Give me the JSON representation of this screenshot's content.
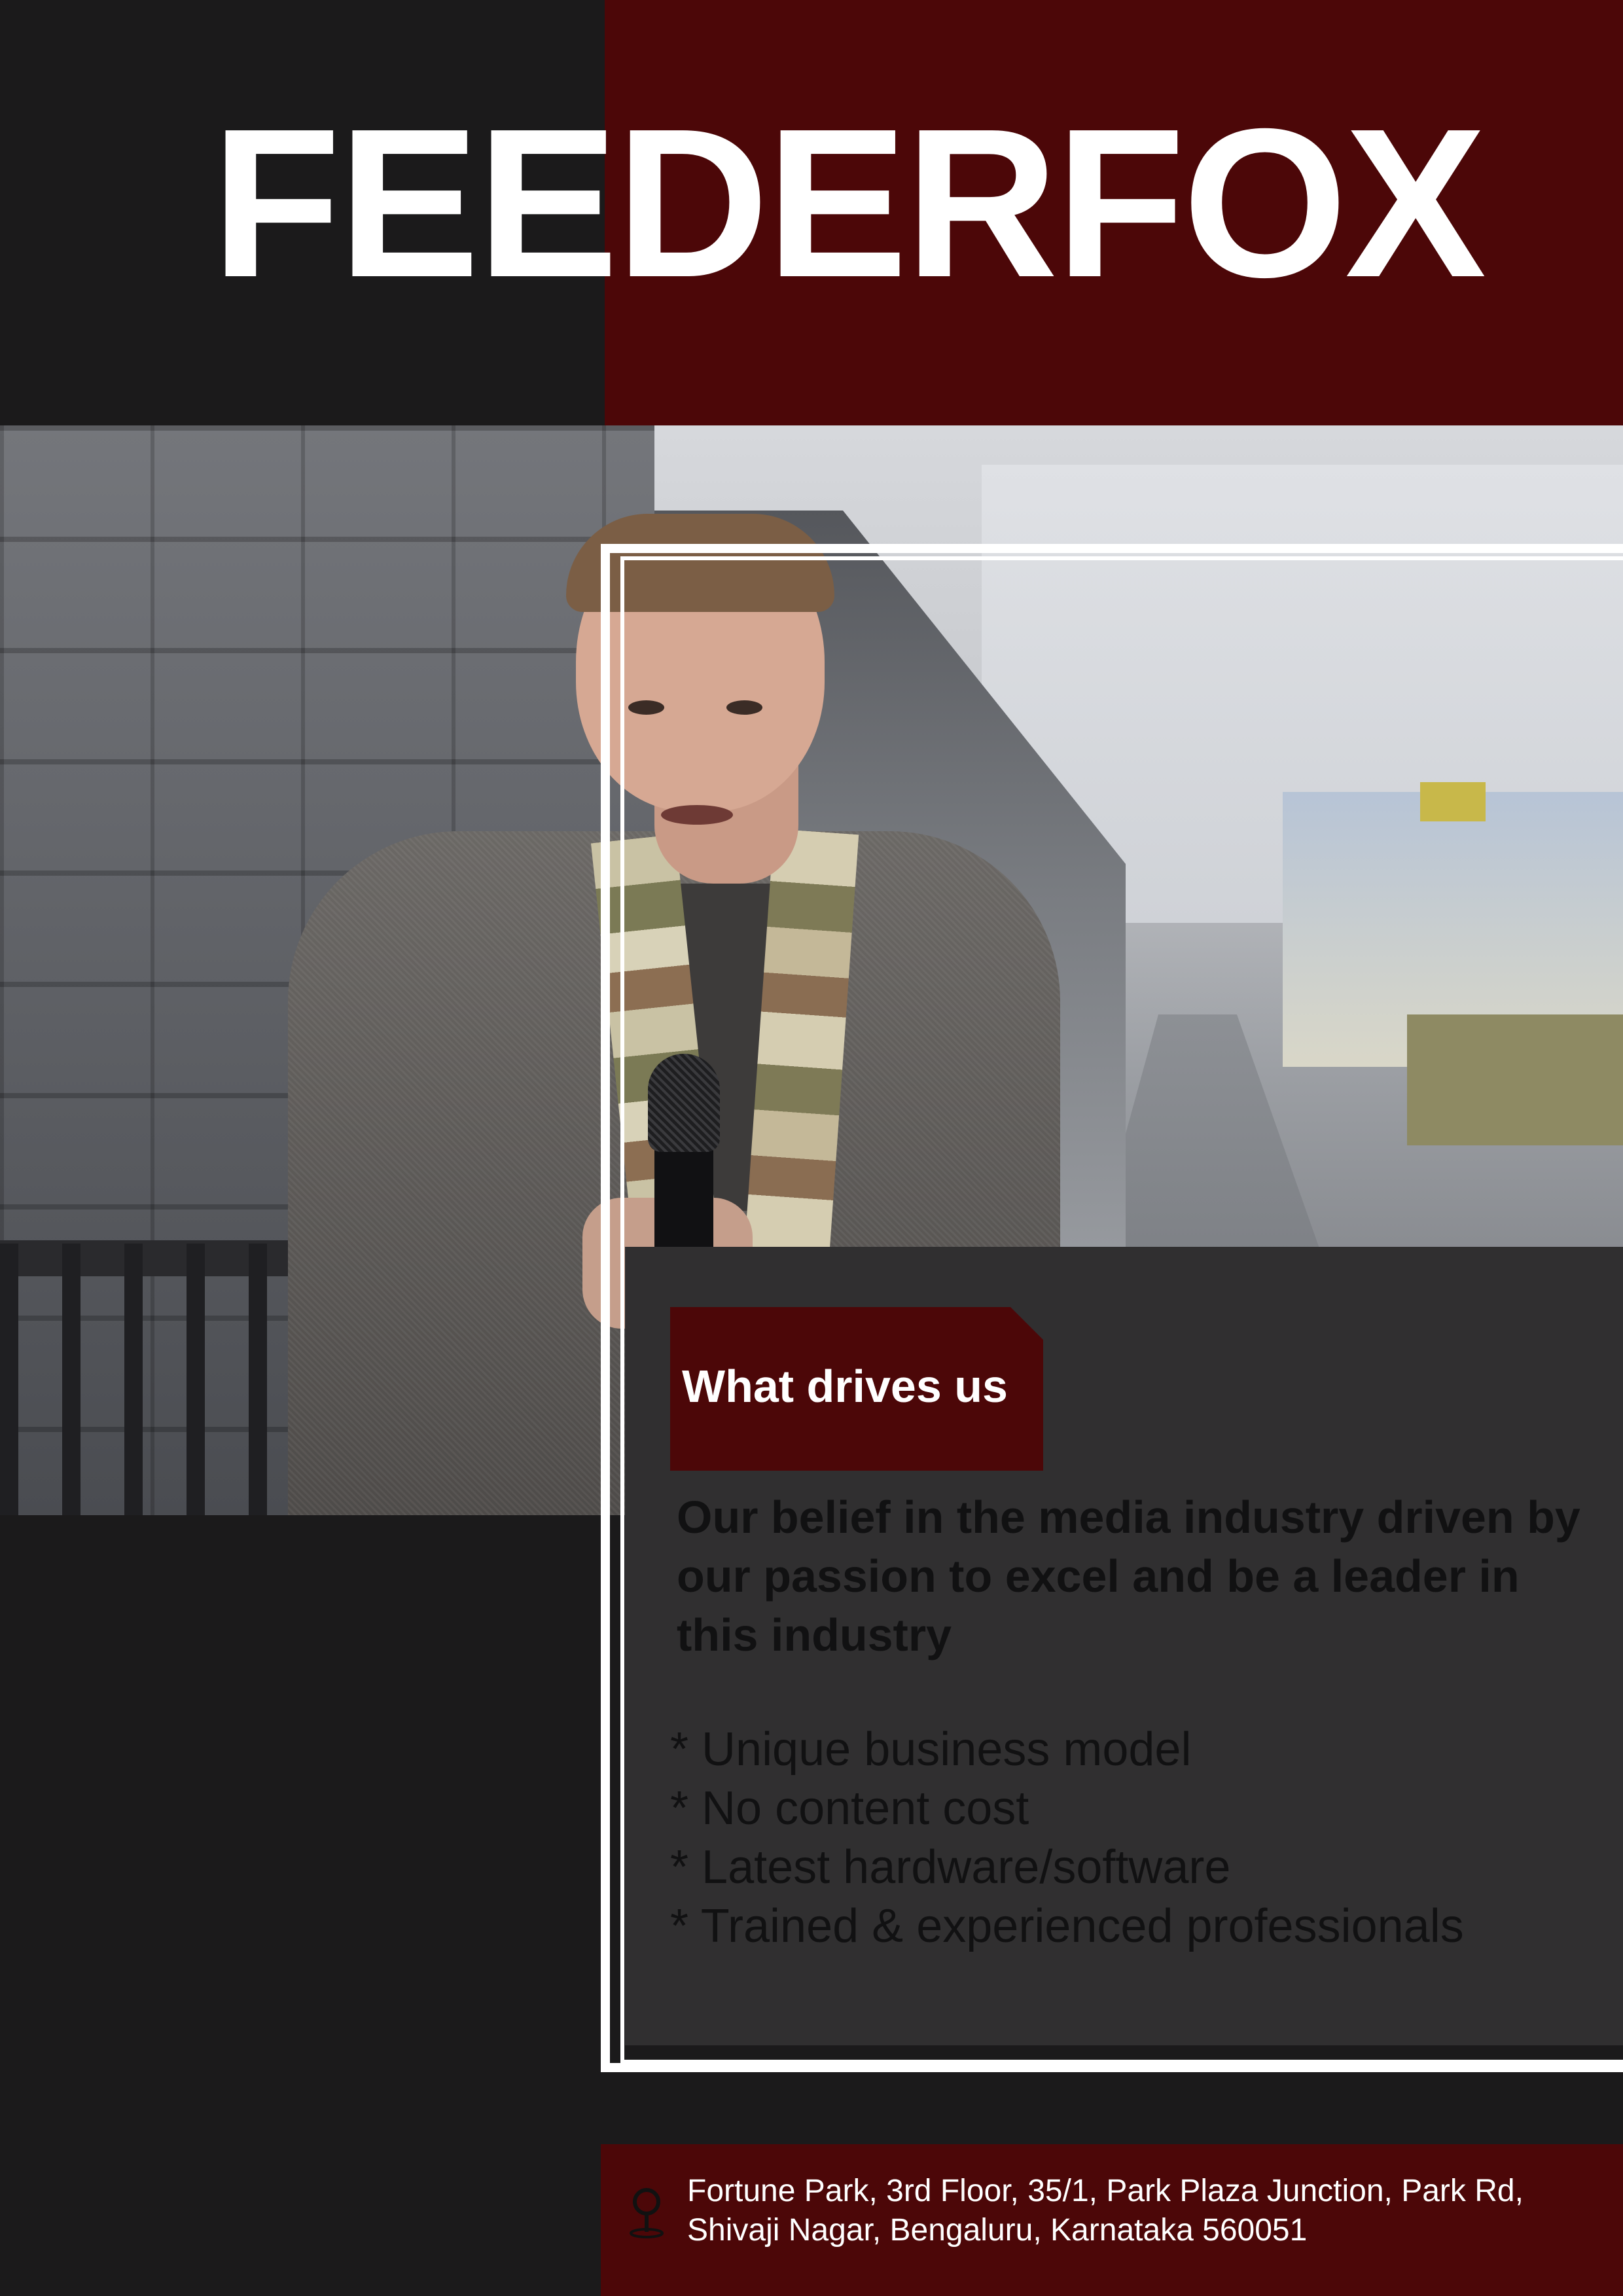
{
  "brand": {
    "title": "FEEDERFOX",
    "colors": {
      "primary": "#4c0708",
      "dark": "#1b1a1b",
      "panel": "#302f30",
      "text_light": "#ffffff"
    }
  },
  "photo": {
    "subject": "reporter-holding-microphone"
  },
  "section": {
    "tag_label": "What drives us",
    "belief_lines": [
      "Our belief in the media industry driven by",
      "our passion to excel and be a leader in",
      "this industry"
    ],
    "bullets": [
      "* Unique business model",
      "* No content cost",
      "* Latest hardware/software",
      "* Trained & experienced professionals"
    ]
  },
  "footer": {
    "icon": "location-pin-icon",
    "address_lines": [
      "Fortune Park, 3rd Floor, 35/1, Park Plaza Junction, Park Rd,",
      "Shivaji Nagar, Bengaluru, Karnataka 560051"
    ]
  }
}
